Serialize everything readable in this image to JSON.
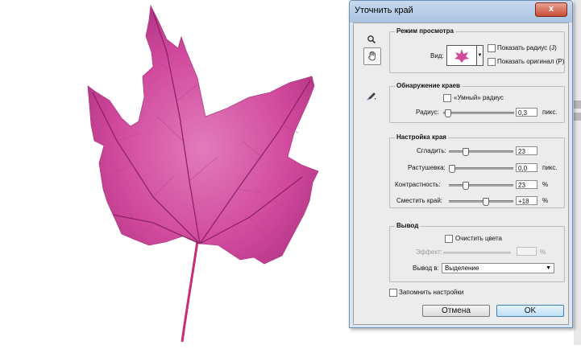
{
  "dialog": {
    "title": "Уточнить край",
    "close_glyph": "x"
  },
  "view_mode": {
    "title": "Режим просмотра",
    "view_label": "Вид:",
    "show_radius": "Показать радиус (J)",
    "show_original": "Показать оригинал (P)"
  },
  "edge_detection": {
    "title": "Обнаружение краев",
    "smart_radius": "«Умный» радиус",
    "radius_label": "Радиус:",
    "radius_value": "0,3",
    "radius_unit": "пикс."
  },
  "adjust_edge": {
    "title": "Настройка края",
    "smooth_label": "Сгладить:",
    "smooth_value": "23",
    "feather_label": "Растушевка:",
    "feather_value": "0,0",
    "feather_unit": "пикс.",
    "contrast_label": "Контрастность:",
    "contrast_value": "23",
    "contrast_unit": "%",
    "shift_label": "Сместить край:",
    "shift_value": "+18",
    "shift_unit": "%"
  },
  "output": {
    "title": "Вывод",
    "decontaminate": "Очистить цвета",
    "effect_label": "Эффект:",
    "effect_unit": "%",
    "output_to_label": "Вывод в:",
    "output_to_value": "Выделение"
  },
  "remember": "Запомнить настройки",
  "buttons": {
    "cancel": "Отмена",
    "ok": "OK"
  },
  "sliders": {
    "radius_level": 0.02,
    "smooth_level": 0.23,
    "feather_level": 0.0,
    "contrast_level": 0.23,
    "shift_level": 0.59
  },
  "icons": [
    "zoom-icon",
    "hand-icon",
    "refine-brush-icon",
    "close-icon",
    "dropdown-arrow-icon"
  ],
  "colors": {
    "leaf_main": "#d0489c",
    "leaf_dark": "#9a2872",
    "leaf_light": "#ea86c6",
    "dialog_frame": "#dbe6f3",
    "close_red": "#c84b34",
    "ok_blue": "#bfe0f5"
  }
}
